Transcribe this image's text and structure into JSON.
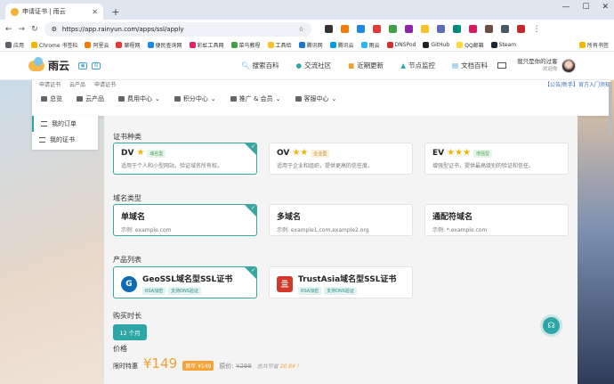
{
  "browser": {
    "tab_title": "申请证书 | 雨云",
    "url": "https://app.rainyun.com/apps/ssl/apply",
    "bookmarks": [
      "应用",
      "Chrome 书签栏",
      "阿里云",
      "聊程网",
      "便民查询网",
      "彩虹工具网",
      "菜鸟教程",
      "工具给",
      "腾讯网",
      "腾讯云",
      "雨云",
      "DNSPod",
      "GitHub",
      "QQ邮箱",
      "Steam"
    ],
    "all_bookmarks": "所有书签"
  },
  "site": {
    "logo": "雨云",
    "nav": [
      {
        "icon": "search-icon",
        "label": "搜索百科"
      },
      {
        "icon": "chat-icon",
        "label": "交流社区"
      },
      {
        "icon": "news-icon",
        "label": "近期更新"
      },
      {
        "icon": "monitor-icon",
        "label": "节点监控"
      },
      {
        "icon": "book-icon",
        "label": "文档百科"
      }
    ],
    "user_name": "我只是你的过客",
    "user_welcome": "欢迎你"
  },
  "breadcrumb": {
    "a": "申请证书",
    "b": "云产品",
    "c": "申请证书",
    "right": "【公告/新手】官方入门须知"
  },
  "menu": [
    "总览",
    "云产品",
    "费用中心",
    "积分中心",
    "推广 & 会员",
    "客服中心"
  ],
  "sidebar": [
    "我的订单",
    "我的证书"
  ],
  "sections": {
    "cert_type": "证书种类",
    "domain_type": "域名类型",
    "products": "产品列表",
    "duration": "购买时长",
    "price": "价格"
  },
  "cert_types": [
    {
      "name": "DV",
      "stars": "★",
      "tag": "域名型",
      "desc": "适用于个人和小型网站，验证域名所有权。",
      "selected": true
    },
    {
      "name": "OV",
      "stars": "★★",
      "tag": "企业型",
      "desc": "适用于企业和组织，提供更高的信任度。",
      "selected": false
    },
    {
      "name": "EV",
      "stars": "★★★",
      "tag": "增强型",
      "desc": "增强型证书，提供最高级别的验证和信任。",
      "selected": false
    }
  ],
  "domain_types": [
    {
      "name": "单域名",
      "desc": "示例: example.com",
      "selected": true
    },
    {
      "name": "多域名",
      "desc": "示例: example1.com,example2.org",
      "selected": false
    },
    {
      "name": "通配符域名",
      "desc": "示例: *.example.com",
      "selected": false
    }
  ],
  "products": [
    {
      "name": "GeoSSL域名型SSL证书",
      "tags": [
        "RSA加密",
        "支持DNS验证"
      ],
      "logo": "G",
      "selected": true
    },
    {
      "name": "TrustAsia域名型SSL证书",
      "tags": [
        "RSA加密",
        "支持DNS验证"
      ],
      "logo": "亖",
      "selected": false
    }
  ],
  "duration": "12 个月",
  "pricing": {
    "label": "限时特惠",
    "price": "¥149",
    "discount_tag": "首年 ¥149",
    "orig_label": "原价:",
    "orig_price": "¥298",
    "save_text": "总共节省",
    "save_amount": "20.8¥ !"
  },
  "colors": {
    "accent": "#2ea6a6",
    "price": "#f0a030"
  }
}
